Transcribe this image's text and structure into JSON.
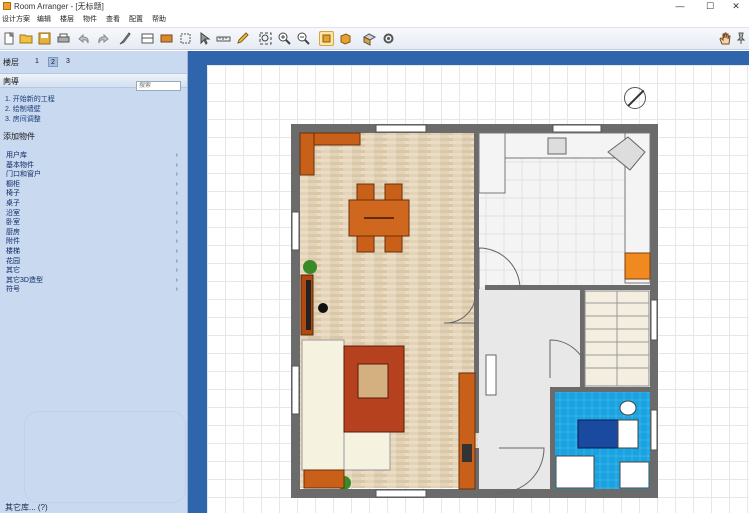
{
  "window": {
    "title": "Room Arranger - [无标题]",
    "minimize": "—",
    "maximize": "☐",
    "close": "✕"
  },
  "menu": [
    "设计方案",
    "编辑",
    "楼层",
    "物件",
    "查看",
    "配置",
    "帮助"
  ],
  "floor": {
    "label": "楼层",
    "tabs": [
      "1",
      "2",
      "3"
    ],
    "selected": "2"
  },
  "wizard": {
    "heading": "向導",
    "steps": [
      "1.  开始新的工程",
      "2.  绘制墙壁",
      "3.  房间调整"
    ]
  },
  "objects": {
    "heading": "添加物件",
    "search_placeholder": "搜索",
    "categories": [
      "用户库",
      "基本物件",
      "门口和窗户",
      "橱柜",
      "椅子",
      "桌子",
      "沿室",
      "卧室",
      "厨房",
      "附件",
      "楼梯",
      "花园",
      "其它",
      "其它3D造型",
      "符号"
    ]
  },
  "footer": {
    "library": "其它库...  (?)"
  },
  "colors": {
    "canvas_frame": "#2f65aa",
    "sidebar": "#c9d9ef",
    "wall": "#6b6b6b",
    "wood_floor": "#e3d3b8",
    "tile_floor": "#f2f2f2",
    "bathroom_blue": "#1aa3e0",
    "sofa_frame": "#b5411f",
    "table": "#c85a18"
  },
  "icons": [
    "new-icon",
    "open-icon",
    "save-icon",
    "print-icon",
    "undo-icon",
    "redo-icon",
    "brush-icon",
    "window-icon",
    "furniture-icon",
    "select-icon",
    "cursor-icon",
    "measure-icon",
    "pencil-icon",
    "zoom-fit-icon",
    "zoom-in-icon",
    "zoom-out-icon",
    "2d-view-icon",
    "3d-view-icon",
    "3d-box-icon",
    "settings-icon",
    "hand-icon",
    "pin-icon"
  ]
}
